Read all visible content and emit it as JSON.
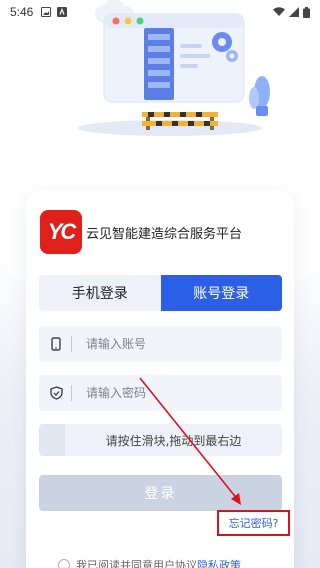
{
  "status_bar": {
    "time": "5:46"
  },
  "app": {
    "brand_name": "云见智能建造综合服务平台",
    "logo_text": "YC"
  },
  "tabs": [
    {
      "label": "手机登录",
      "active": false
    },
    {
      "label": "账号登录",
      "active": true
    }
  ],
  "form": {
    "account_placeholder": "请输入账号",
    "password_placeholder": "请输入密码",
    "slider_text": "请按住滑块,拖动到最右边",
    "login_label": "登录",
    "forgot_label": "忘记密码?"
  },
  "agreement": {
    "prefix": "我已阅读并同意用户协议",
    "link": "隐私政策"
  },
  "colors": {
    "accent": "#2b5fe6",
    "brand_red": "#e0201a",
    "annotation_red": "#d8141a",
    "disabled_button": "#cbd3e2"
  },
  "icons": {
    "phone": "phone-icon",
    "shield": "shield-check-icon",
    "wifi": "wifi-icon",
    "signal": "signal-icon",
    "battery": "battery-icon"
  }
}
